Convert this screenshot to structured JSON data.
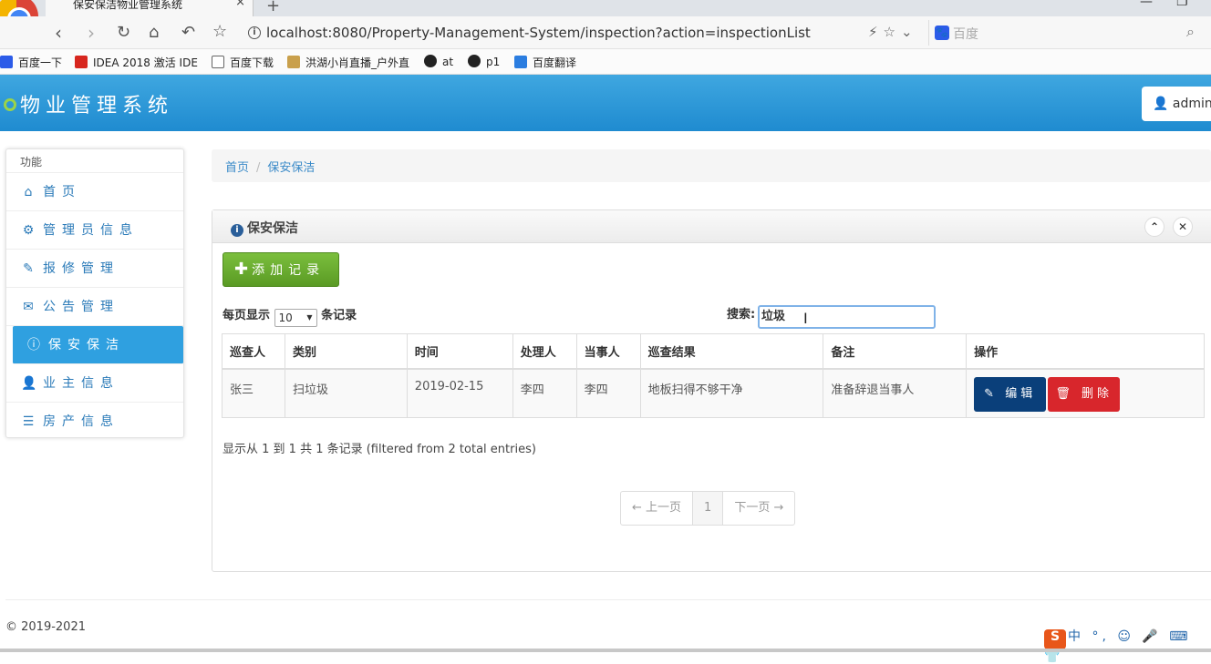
{
  "browser": {
    "tab_title": "保安保洁物业管理系统",
    "tab_close": "×",
    "new_tab": "+",
    "url": "localhost:8080/Property-Management-System/inspection?action=inspectionList",
    "search_placeholder": "百度",
    "bookmarks": [
      "百度一下",
      "IDEA 2018 激活 IDE",
      "百度下载",
      "洪湖小肖直播_户外直",
      "at",
      "p1",
      "百度翻译"
    ]
  },
  "header": {
    "brand": "物业管理系统",
    "user": "admin"
  },
  "sidebar": {
    "heading": "功能",
    "items": [
      {
        "label": "首页",
        "icon": "home-icon"
      },
      {
        "label": "管理员信息",
        "icon": "gear-icon"
      },
      {
        "label": "报修管理",
        "icon": "wrench-icon"
      },
      {
        "label": "公告管理",
        "icon": "envelope-icon"
      },
      {
        "label": "保安保洁",
        "icon": "info-icon"
      },
      {
        "label": "业主信息",
        "icon": "user-icon"
      },
      {
        "label": "房产信息",
        "icon": "list-icon"
      }
    ],
    "active_index": 4
  },
  "breadcrumb": {
    "home": "首页",
    "sep": "/",
    "current": "保安保洁"
  },
  "panel": {
    "title": "保安保洁",
    "add_button": "添加记录",
    "length_prefix": "每页显示",
    "length_value": "10",
    "length_suffix": "条记录",
    "search_label": "搜索:",
    "search_value": "垃圾",
    "columns": [
      "巡查人",
      "类别",
      "时间",
      "处理人",
      "当事人",
      "巡查结果",
      "备注",
      "操作"
    ],
    "rows": [
      {
        "inspector": "张三",
        "category": "扫垃圾",
        "date": "2019-02-15",
        "handler": "李四",
        "party": "李四",
        "result": "地板扫得不够干净",
        "remark": "准备辞退当事人",
        "edit": "编辑",
        "delete": "删除"
      }
    ],
    "info": "显示从 1 到 1 共 1 条记录 (filtered from 2 total entries)",
    "pager": {
      "prev": "← 上一页",
      "current": "1",
      "next": "下一页 →"
    }
  },
  "footer": "© 2019-2021",
  "ime": "中 °,"
}
